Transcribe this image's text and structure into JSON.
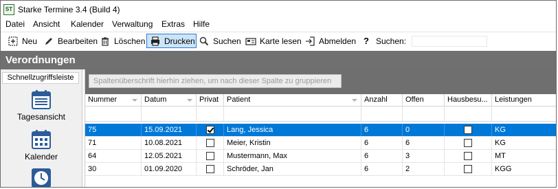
{
  "window": {
    "title": "Starke Termine 3.4 (Build 4)",
    "icon_text": "ST"
  },
  "menu": [
    "Datei",
    "Ansicht",
    "Kalender",
    "Verwaltung",
    "Extras",
    "Hilfe"
  ],
  "toolbar": {
    "new_label": "Neu",
    "edit_label": "Bearbeiten",
    "delete_label": "Löschen",
    "print_label": "Drucken",
    "find_label": "Suchen",
    "card_label": "Karte lesen",
    "logout_label": "Abmelden",
    "search_label": "Suchen:",
    "search_value": ""
  },
  "section": {
    "title": "Verordnungen"
  },
  "sidebar": {
    "title": "Schnellzugriffsleiste",
    "items": [
      {
        "label": "Tagesansicht",
        "icon": "calendar-day-icon"
      },
      {
        "label": "Kalender",
        "icon": "calendar-grid-icon"
      },
      {
        "label": "",
        "icon": "clock-icon"
      }
    ]
  },
  "grid": {
    "group_hint": "Spaltenüberschrift hierhin ziehen, um nach dieser Spalte zu gruppieren",
    "columns": [
      "Nummer",
      "Datum",
      "Privat",
      "Patient",
      "Anzahl",
      "Offen",
      "Hausbesu...",
      "Leistungen"
    ],
    "rows": [
      {
        "nummer": "75",
        "datum": "15.09.2021",
        "privat": true,
        "patient": "Lang, Jessica",
        "anzahl": "6",
        "offen": "0",
        "hausbesuch": false,
        "leistungen": "KG",
        "selected": true
      },
      {
        "nummer": "71",
        "datum": "10.08.2021",
        "privat": false,
        "patient": "Meier, Kristin",
        "anzahl": "6",
        "offen": "6",
        "hausbesuch": false,
        "leistungen": "KG",
        "selected": false
      },
      {
        "nummer": "64",
        "datum": "12.05.2021",
        "privat": false,
        "patient": "Mustermann, Max",
        "anzahl": "6",
        "offen": "3",
        "hausbesuch": false,
        "leistungen": "MT",
        "selected": false
      },
      {
        "nummer": "30",
        "datum": "01.09.2020",
        "privat": false,
        "patient": "Schröder, Jan",
        "anzahl": "6",
        "offen": "2",
        "hausbesuch": false,
        "leistungen": "KGG",
        "selected": false
      }
    ]
  },
  "colors": {
    "selection": "#0078d7",
    "header_bg": "#707070",
    "active_button": "#cce4f7"
  }
}
